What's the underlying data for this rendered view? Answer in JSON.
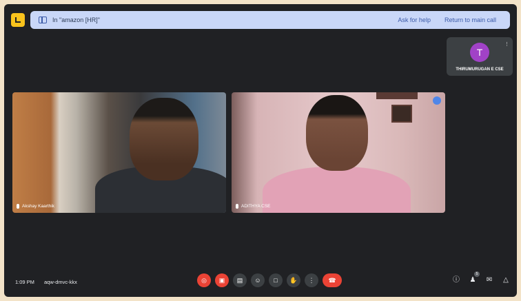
{
  "banner": {
    "room_label": "In \"amazon [HR]\"",
    "ask_help": "Ask for help",
    "return": "Return to main call"
  },
  "self": {
    "initial": "T",
    "name": "THIRUMURUGAN E CSE"
  },
  "participants": [
    {
      "name": "Akshay Kaarthik"
    },
    {
      "name": "ADITHYA  CSE"
    }
  ],
  "footer": {
    "time": "1:09 PM",
    "meeting_code": "aqw-dmvc-kkx",
    "people_count": "5"
  },
  "icons": {
    "mic": "mic-off-icon",
    "camera": "camera-off-icon",
    "captions": "captions-icon",
    "emoji": "emoji-icon",
    "present": "present-icon",
    "hand": "raise-hand-icon",
    "more": "more-vert-icon",
    "leave": "leave-call-icon"
  },
  "colors": {
    "accent": "#4f86e8",
    "danger": "#ea4335",
    "avatar": "#a142c7"
  }
}
